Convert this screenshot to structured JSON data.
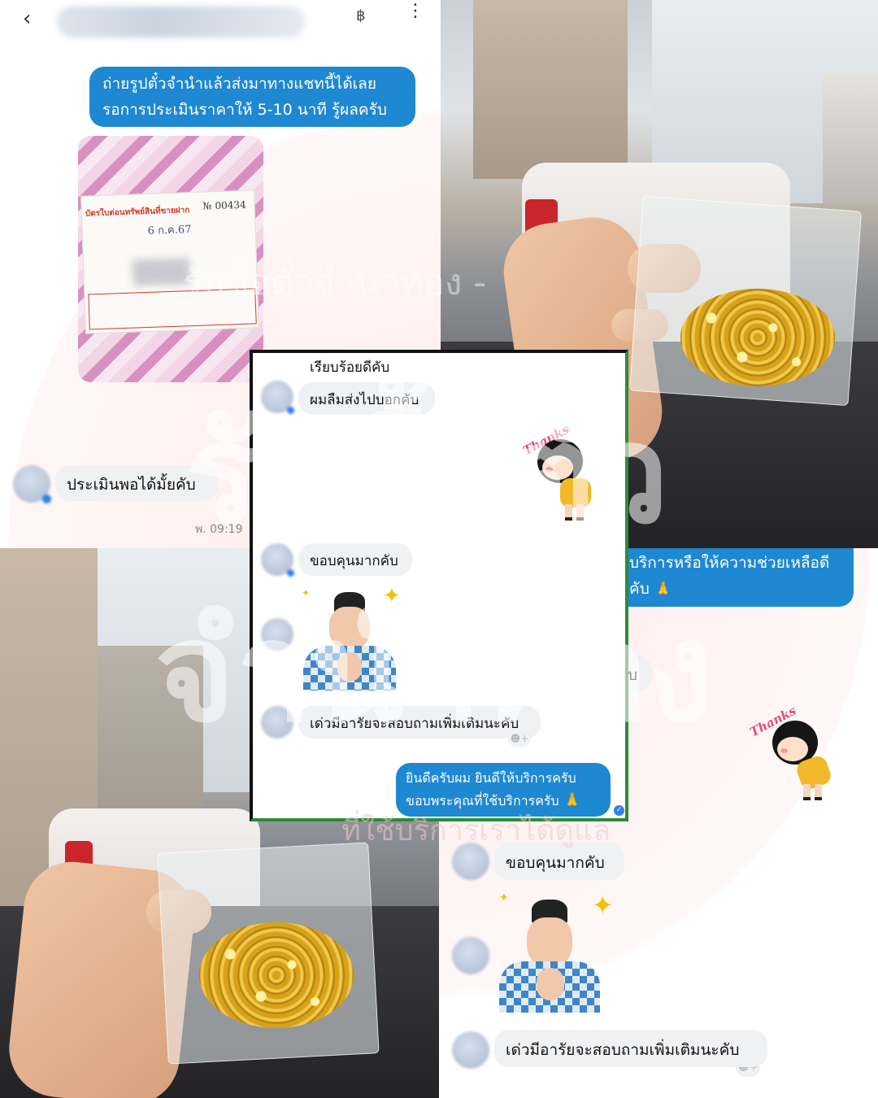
{
  "header": {
    "back_icon": "‹",
    "currency_icon": "฿",
    "more_icon": "⋮"
  },
  "watermark": {
    "line1": "รับซื้อตั๋ว",
    "line2": "จำนำทอง",
    "small": "รับซื้อตั๋วจำนำทอง -",
    "tagline": "ที่ใช้บริการเราได้ดูแล"
  },
  "chat_left": {
    "outgoing_prompt": [
      "ถ่ายรูปตั๋วจำนำแล้วส่งมาทางแชทนี้ได้เลย",
      "รอการประเมินราคาให้ 5-10 นาที รู้ผลครับ"
    ],
    "incoming_question": "ประเมินพอได้มั้ยคับ",
    "time": "พ. 09:19"
  },
  "ticket": {
    "number_label": "№",
    "number": "00434",
    "title": "บัตรใบต่อนทรัพย์สินที่ขายฝาก",
    "handwritten": "6 ก.ค.67"
  },
  "center_chat": {
    "msg1": "เรียบร้อยดีคับ",
    "msg2": "ผมลืมส่งไปบอกคับ",
    "msg3": "ขอบคุนมากคับ",
    "msg4": "เด่วมีอารัยจะสอบถามเพิ่มเติมนะคับ",
    "reply": [
      "ยินดีครับผม ยินดีให้บริการครับ",
      "ขอบพระคุณที่ใช้บริการครับ"
    ],
    "pray_emoji": "🙏",
    "react_icon": "☻+",
    "check_icon": "✓"
  },
  "right_chat": {
    "partial_bubble": [
      "บริการหรือให้ความช่วยเหลือดี",
      "คับ"
    ],
    "partial_incoming": "บ",
    "thanks_msg": "ขอบคุนมากคับ",
    "followup_msg": "เด่วมีอารัยจะสอบถามเพิ่มเติมนะคับ",
    "react_icon": "☻+"
  },
  "stickers": {
    "thanks_text": "Thanks",
    "sparkle": "✦"
  },
  "colors": {
    "accent_blue": "#1e88d2",
    "bubble_gray": "#f0f1f3",
    "gold": "#e2b12a"
  }
}
